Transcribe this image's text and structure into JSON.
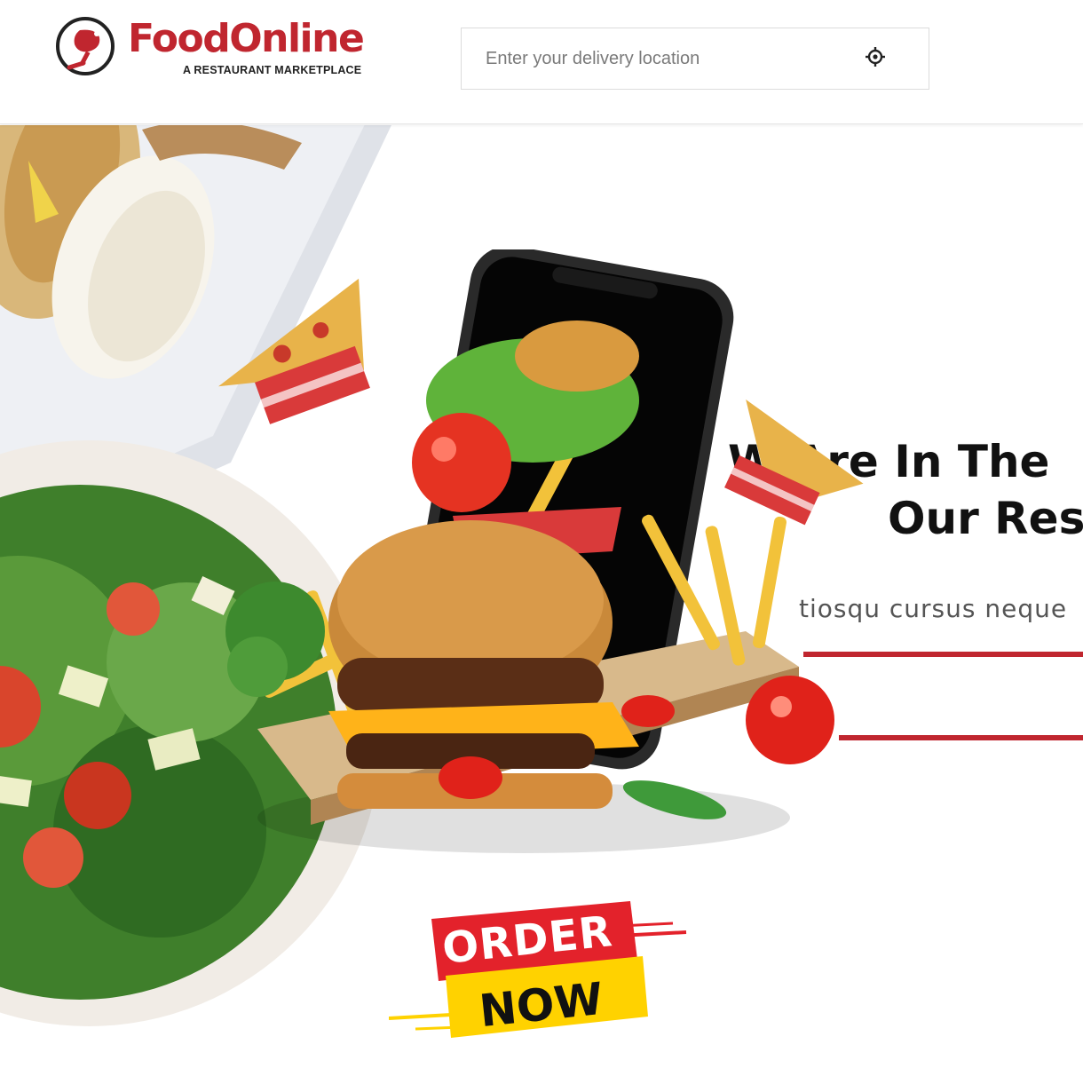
{
  "header": {
    "logo": {
      "name": "FoodOnline",
      "tagline": "A RESTAURANT MARKETPLACE"
    },
    "search": {
      "placeholder": "Enter your delivery location",
      "value": "",
      "icon": "crosshair-locate-icon"
    }
  },
  "hero": {
    "headline_line1": "W  Are In The",
    "headline_line2": "Our Res",
    "subtitle": "tiosqu cursus neque",
    "order_button": {
      "line1": "ORDER",
      "line2": "NOW"
    }
  },
  "colors": {
    "brand_red": "#c0262f",
    "badge_red": "#e3222b",
    "badge_yellow": "#ffd200",
    "text_dark": "#111111",
    "text_gray": "#555555"
  }
}
